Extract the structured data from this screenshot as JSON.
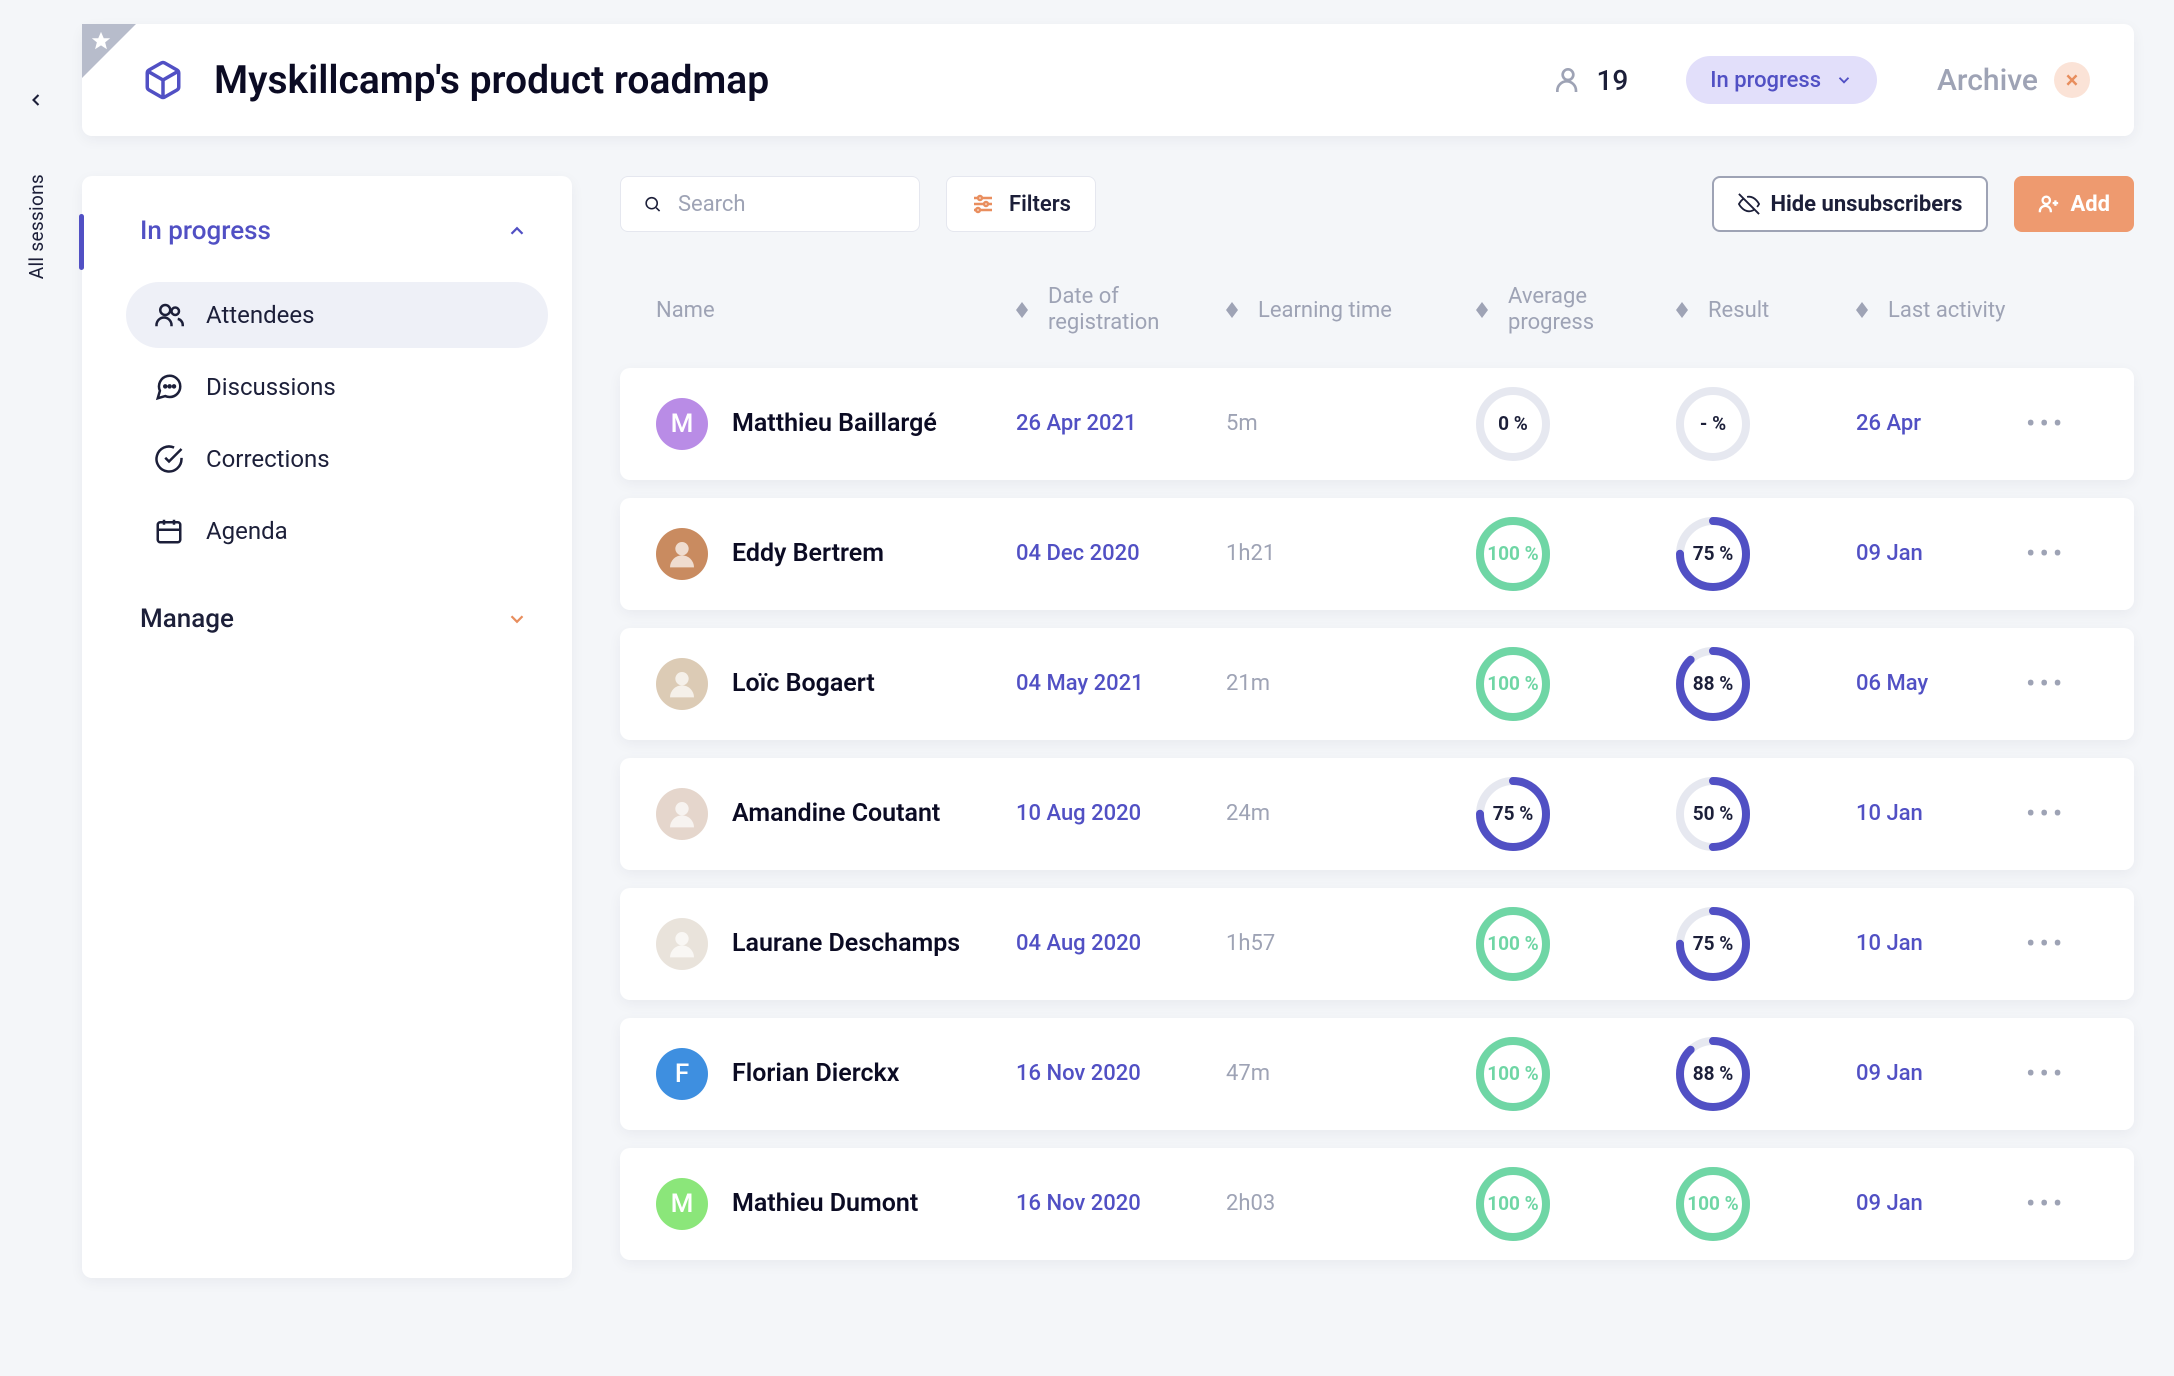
{
  "rail": {
    "label": "All sessions"
  },
  "header": {
    "title": "Myskillcamp's product roadmap",
    "count": "19",
    "status": "In progress",
    "archive": "Archive"
  },
  "sidebar": {
    "section1": "In progress",
    "items": [
      {
        "label": "Attendees"
      },
      {
        "label": "Discussions"
      },
      {
        "label": "Corrections"
      },
      {
        "label": "Agenda"
      }
    ],
    "section2": "Manage"
  },
  "toolbar": {
    "search_placeholder": "Search",
    "filters": "Filters",
    "hide": "Hide unsubscribers",
    "add": "Add"
  },
  "columns": {
    "name": "Name",
    "date": "Date of registration",
    "time": "Learning time",
    "progress": "Average progress",
    "result": "Result",
    "last": "Last activity"
  },
  "rows": [
    {
      "name": "Matthieu Baillargé",
      "date": "26 Apr 2021",
      "time": "5m",
      "progress": {
        "label": "0 %",
        "pct": 0,
        "color": "#D3D5DE",
        "txt": "#1C1F39"
      },
      "result": {
        "label": "- %",
        "pct": 0,
        "color": "#D3D5DE",
        "txt": "#1C1F39"
      },
      "last": "26 Apr",
      "avatar": {
        "type": "letter",
        "letter": "M",
        "bg": "#B98CE6"
      }
    },
    {
      "name": "Eddy Bertrem",
      "date": "04 Dec 2020",
      "time": "1h21",
      "progress": {
        "label": "100 %",
        "pct": 100,
        "color": "#6FD6A5",
        "txt": "#6FD6A5"
      },
      "result": {
        "label": "75 %",
        "pct": 75,
        "color": "#5150C4",
        "txt": "#1C1F39"
      },
      "last": "09 Jan",
      "avatar": {
        "type": "photo",
        "bg": "#C98B60"
      }
    },
    {
      "name": "Loïc Bogaert",
      "date": "04 May 2021",
      "time": "21m",
      "progress": {
        "label": "100 %",
        "pct": 100,
        "color": "#6FD6A5",
        "txt": "#6FD6A5"
      },
      "result": {
        "label": "88 %",
        "pct": 88,
        "color": "#5150C4",
        "txt": "#1C1F39"
      },
      "last": "06 May",
      "avatar": {
        "type": "photo",
        "bg": "#DCCBB5"
      }
    },
    {
      "name": "Amandine Coutant",
      "date": "10 Aug 2020",
      "time": "24m",
      "progress": {
        "label": "75 %",
        "pct": 75,
        "color": "#5150C4",
        "txt": "#1C1F39"
      },
      "result": {
        "label": "50 %",
        "pct": 50,
        "color": "#5150C4",
        "txt": "#1C1F39"
      },
      "last": "10 Jan",
      "avatar": {
        "type": "photo",
        "bg": "#E5D6CC"
      }
    },
    {
      "name": "Laurane Deschamps",
      "date": "04 Aug 2020",
      "time": "1h57",
      "progress": {
        "label": "100 %",
        "pct": 100,
        "color": "#6FD6A5",
        "txt": "#6FD6A5"
      },
      "result": {
        "label": "75 %",
        "pct": 75,
        "color": "#5150C4",
        "txt": "#1C1F39"
      },
      "last": "10 Jan",
      "avatar": {
        "type": "photo",
        "bg": "#E9E3DB"
      }
    },
    {
      "name": "Florian Dierckx",
      "date": "16 Nov 2020",
      "time": "47m",
      "progress": {
        "label": "100 %",
        "pct": 100,
        "color": "#6FD6A5",
        "txt": "#6FD6A5"
      },
      "result": {
        "label": "88 %",
        "pct": 88,
        "color": "#5150C4",
        "txt": "#1C1F39"
      },
      "last": "09 Jan",
      "avatar": {
        "type": "letter",
        "letter": "F",
        "bg": "#3E8FE0"
      }
    },
    {
      "name": "Mathieu Dumont",
      "date": "16 Nov 2020",
      "time": "2h03",
      "progress": {
        "label": "100 %",
        "pct": 100,
        "color": "#6FD6A5",
        "txt": "#6FD6A5"
      },
      "result": {
        "label": "100 %",
        "pct": 100,
        "color": "#6FD6A5",
        "txt": "#6FD6A5"
      },
      "last": "09 Jan",
      "avatar": {
        "type": "letter",
        "letter": "M",
        "bg": "#8BE67A"
      }
    }
  ]
}
